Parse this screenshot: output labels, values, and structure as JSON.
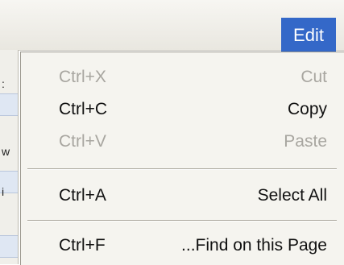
{
  "menubar": {
    "active_menu": "Edit",
    "highlight_color": "#3468c8"
  },
  "edit_menu": {
    "items": [
      {
        "shortcut": "Ctrl+X",
        "label": "Cut",
        "enabled": false
      },
      {
        "shortcut": "Ctrl+C",
        "label": "Copy",
        "enabled": true
      },
      {
        "shortcut": "Ctrl+V",
        "label": "Paste",
        "enabled": false
      },
      {
        "shortcut": "Ctrl+A",
        "label": "Select All",
        "enabled": true
      },
      {
        "shortcut": "Ctrl+F",
        "label": "...Find on this Page",
        "enabled": true
      }
    ]
  },
  "background_window": {
    "glyphs": [
      ":",
      "w",
      "i"
    ]
  }
}
